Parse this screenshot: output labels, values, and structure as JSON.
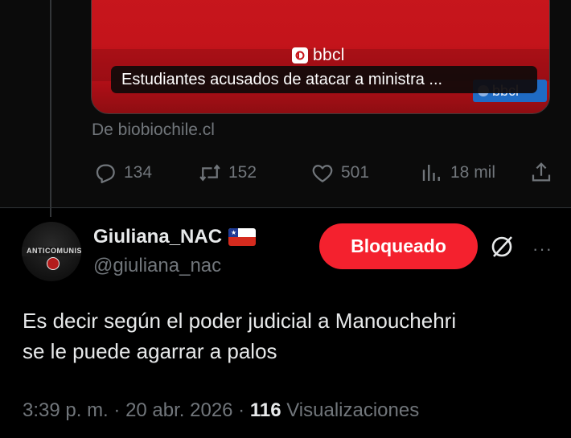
{
  "embed": {
    "logo_text": "bbcl",
    "corner_logo_text": "bbcl",
    "caption": "Estudiantes acusados de atacar a ministra ...",
    "source": "De biobiochile.cl"
  },
  "actions": {
    "replies": "134",
    "reposts": "152",
    "likes": "501",
    "views": "18 mil"
  },
  "post": {
    "display_name": "Giuliana_NAC",
    "handle": "@giuliana_nac",
    "blocked_label": "Bloqueado",
    "avatar_text": "ANTICOMUNISTA",
    "flag_icon": "chile-flag-icon",
    "text_line1": "Es decir según el poder judicial  a Manouchehri",
    "text_line2": "se le puede agarrar a palos",
    "time": "3:39 p. m.",
    "sep1": " · ",
    "date": "20 abr. 2026",
    "sep2": " · ",
    "views_count": "116",
    "views_label": " Visualizaciones"
  },
  "colors": {
    "background": "#000000",
    "muted": "#71767b",
    "blocked_button": "#f4212e",
    "embed_red": "#c8161c"
  }
}
